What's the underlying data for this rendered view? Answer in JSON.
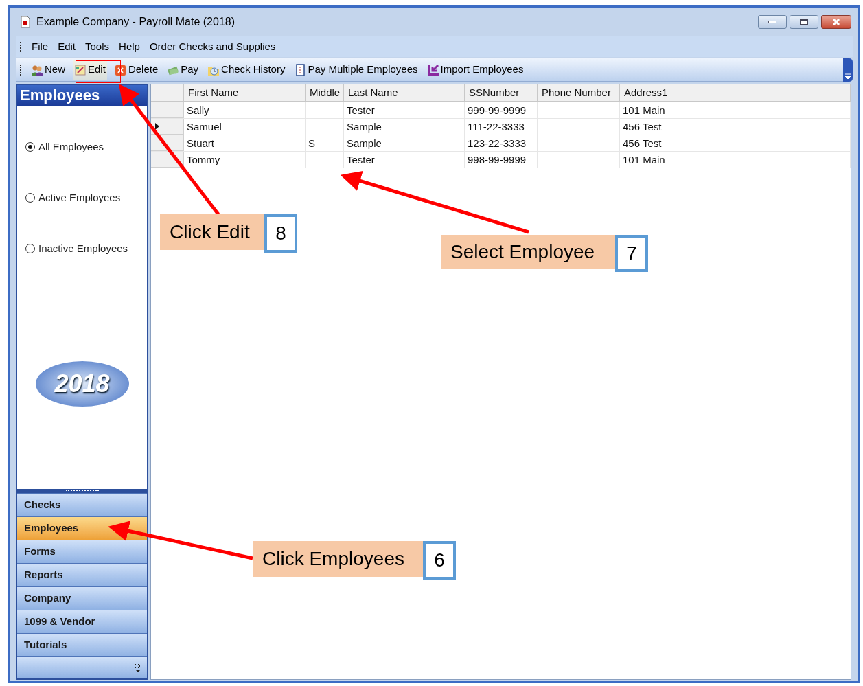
{
  "window": {
    "title": "Example Company - Payroll Mate (2018)"
  },
  "menu": [
    "File",
    "Edit",
    "Tools",
    "Help",
    "Order Checks and Supplies"
  ],
  "toolbar": [
    {
      "kind": "people",
      "label": "New",
      "highlighted": false
    },
    {
      "kind": "edit",
      "label": "Edit",
      "highlighted": true
    },
    {
      "kind": "delete",
      "label": "Delete",
      "highlighted": false
    },
    {
      "kind": "money",
      "label": "Pay",
      "highlighted": false
    },
    {
      "kind": "history",
      "label": "Check History",
      "highlighted": false
    },
    {
      "kind": "doc",
      "label": "Pay Multiple Employees",
      "highlighted": false
    },
    {
      "kind": "import",
      "label": "Import Employees",
      "highlighted": false
    }
  ],
  "sidebar": {
    "title": "Employees",
    "filters": [
      {
        "label": "All Employees",
        "selected": true
      },
      {
        "label": "Active Employees",
        "selected": false
      },
      {
        "label": "Inactive Employees",
        "selected": false
      }
    ],
    "logo": "2018",
    "nav": [
      {
        "label": "Checks",
        "selected": false
      },
      {
        "label": "Employees",
        "selected": true
      },
      {
        "label": "Forms",
        "selected": false
      },
      {
        "label": "Reports",
        "selected": false
      },
      {
        "label": "Company",
        "selected": false
      },
      {
        "label": "1099 & Vendor",
        "selected": false
      },
      {
        "label": "Tutorials",
        "selected": false
      }
    ]
  },
  "table": {
    "columns": [
      "First Name",
      "Middle",
      "Last Name",
      "SSNumber",
      "Phone Number",
      "Address1"
    ],
    "rows": [
      {
        "selected": false,
        "cells": [
          "Sally",
          "",
          "Tester",
          "999-99-9999",
          "",
          "101 Main"
        ]
      },
      {
        "selected": true,
        "cells": [
          "Samuel",
          "",
          "Sample",
          "111-22-3333",
          "",
          "456 Test"
        ]
      },
      {
        "selected": false,
        "cells": [
          "Stuart",
          "S",
          "Sample",
          "123-22-3333",
          "",
          "456 Test"
        ]
      },
      {
        "selected": false,
        "cells": [
          "Tommy",
          "",
          "Tester",
          "998-99-9999",
          "",
          "101 Main"
        ]
      }
    ]
  },
  "annotations": [
    {
      "text": "Click Edit",
      "step": "8"
    },
    {
      "text": "Select Employee",
      "step": "7"
    },
    {
      "text": "Click Employees",
      "step": "6"
    }
  ]
}
